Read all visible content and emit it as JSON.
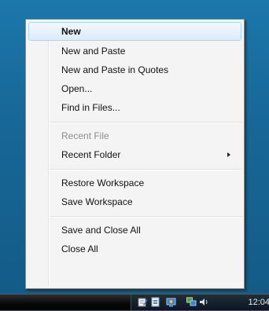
{
  "menu": {
    "items": [
      {
        "label": "New",
        "bold": true,
        "highlighted": true
      },
      {
        "label": "New and Paste"
      },
      {
        "label": "New and Paste in Quotes"
      },
      {
        "label": "Open..."
      },
      {
        "label": "Find in Files..."
      },
      {
        "label": "Recent File",
        "disabled": true
      },
      {
        "label": "Recent Folder",
        "has_submenu": true
      },
      {
        "label": "Restore Workspace"
      },
      {
        "label": "Save Workspace"
      },
      {
        "label": "Save and Close All"
      },
      {
        "label": "Close All"
      }
    ],
    "colors": {
      "background": "#f4f4f4",
      "highlight_border": "#a8d8f8",
      "disabled_text": "#8d8d8d"
    }
  },
  "taskbar": {
    "tray_icons": [
      "notepad-icon",
      "document-icon",
      "gear-network-icon",
      "network-icon",
      "speaker-icon"
    ],
    "clock": "12:04"
  },
  "desktop": {
    "background": "#176797"
  }
}
